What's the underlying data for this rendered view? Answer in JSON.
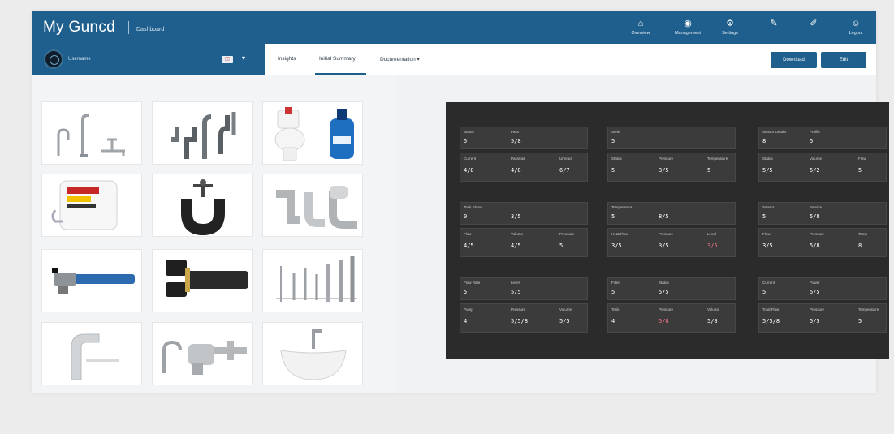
{
  "app": {
    "title": "My Guncd",
    "subtitle": "Dashboard"
  },
  "topnav": [
    {
      "icon": "home-icon",
      "glyph": "⌂",
      "label": "Overview"
    },
    {
      "icon": "cart-icon",
      "glyph": "◉",
      "label": "Management"
    },
    {
      "icon": "settings-icon",
      "glyph": "⚙",
      "label": "Settings"
    },
    {
      "icon": "wrench-icon",
      "glyph": "✎",
      "label": ""
    },
    {
      "icon": "tool-icon",
      "glyph": "✐",
      "label": ""
    },
    {
      "icon": "user-icon",
      "glyph": "☺",
      "label": "Logout"
    }
  ],
  "user": {
    "name": "Username",
    "flag_glyph": "◫",
    "caret": "▾"
  },
  "tabs": [
    {
      "label": "Insights"
    },
    {
      "label": "Initial Summary"
    },
    {
      "label": "Documentation ▾"
    }
  ],
  "buttons": {
    "primary": "Download",
    "secondary": "Edit"
  },
  "tiles": [
    {
      "name": "faucet-tile",
      "item": "faucets"
    },
    {
      "name": "pipe-fittings-tile",
      "item": "pipe fittings"
    },
    {
      "name": "toilet-cleaner-tile",
      "item": "toilet and cleaner"
    },
    {
      "name": "water-heater-tile",
      "item": "water heater"
    },
    {
      "name": "p-trap-tile",
      "item": "p-trap"
    },
    {
      "name": "elbow-pipes-tile",
      "item": "elbow pipes"
    },
    {
      "name": "blue-hose-tile",
      "item": "blue hose"
    },
    {
      "name": "black-pipe-tile",
      "item": "black pipe"
    },
    {
      "name": "rods-tile",
      "item": "rods"
    },
    {
      "name": "basin-faucet-tile",
      "item": "basin faucet"
    },
    {
      "name": "valve-tile",
      "item": "valve assembly"
    },
    {
      "name": "sink-tile",
      "item": "sink"
    }
  ],
  "stats": [
    {
      "top": {
        "l1": "Status",
        "l2": "Pass",
        "v1": "5",
        "v2": "5/8"
      },
      "bottom": {
        "l1": "Current",
        "l2": "Pass/fail",
        "l3": "Unread",
        "v1": "4/8",
        "v2": "4/8",
        "v3": "6/7",
        "alert": [
          false,
          false,
          false
        ]
      }
    },
    {
      "top": {
        "l1": "Serie",
        "l2": "",
        "v1": "5",
        "v2": ""
      },
      "bottom": {
        "l1": "Status",
        "l2": "Pressure",
        "l3": "Temperature",
        "v1": "5",
        "v2": "3/5",
        "v3": "5",
        "alert": [
          false,
          false,
          false
        ]
      }
    },
    {
      "top": {
        "l1": "Sensor Details",
        "l2": "Profile",
        "v1": "8",
        "v2": "5"
      },
      "bottom": {
        "l1": "Status",
        "l2": "Volume",
        "l3": "Flow",
        "v1": "5/5",
        "v2": "5/2",
        "v3": "5",
        "alert": [
          false,
          false,
          false
        ]
      }
    },
    {
      "top": {
        "l1": "Tank Status",
        "l2": "",
        "v1": "0",
        "v2": "3/5"
      },
      "bottom": {
        "l1": "Flow",
        "l2": "Volume",
        "l3": "Pressure",
        "v1": "4/5",
        "v2": "4/5",
        "v3": "5",
        "alert": [
          false,
          false,
          false
        ]
      }
    },
    {
      "top": {
        "l1": "Temperature",
        "l2": "",
        "v1": "5",
        "v2": "8/5"
      },
      "bottom": {
        "l1": "Heat/Flow",
        "l2": "Pressure",
        "l3": "Level",
        "v1": "3/5",
        "v2": "3/5",
        "v3": "3/5",
        "alert": [
          false,
          false,
          true
        ]
      }
    },
    {
      "top": {
        "l1": "Sensor",
        "l2": "Service",
        "v1": "5",
        "v2": "5/8"
      },
      "bottom": {
        "l1": "Flow",
        "l2": "Pressure",
        "l3": "Temp",
        "v1": "3/5",
        "v2": "5/8",
        "v3": "8",
        "alert": [
          false,
          false,
          false
        ]
      }
    },
    {
      "top": {
        "l1": "Flow Rate",
        "l2": "Level",
        "v1": "5",
        "v2": "5/5"
      },
      "bottom": {
        "l1": "Pump",
        "l2": "Pressure",
        "l3": "Volume",
        "v1": "4",
        "v2": "5/5/8",
        "v3": "5/5",
        "alert": [
          false,
          false,
          false
        ]
      }
    },
    {
      "top": {
        "l1": "Filter",
        "l2": "Status",
        "v1": "5",
        "v2": "5/5"
      },
      "bottom": {
        "l1": "Tank",
        "l2": "Pressure",
        "l3": "Volume",
        "v1": "4",
        "v2": "5/8",
        "v3": "5/8",
        "alert": [
          false,
          true,
          false
        ]
      }
    },
    {
      "top": {
        "l1": "Current",
        "l2": "Power",
        "v1": "5",
        "v2": "5/5"
      },
      "bottom": {
        "l1": "Total Flow",
        "l2": "Pressure",
        "l3": "Temperature",
        "v1": "5/5/8",
        "v2": "5/5",
        "v3": "5",
        "alert": [
          false,
          false,
          false
        ]
      }
    }
  ]
}
